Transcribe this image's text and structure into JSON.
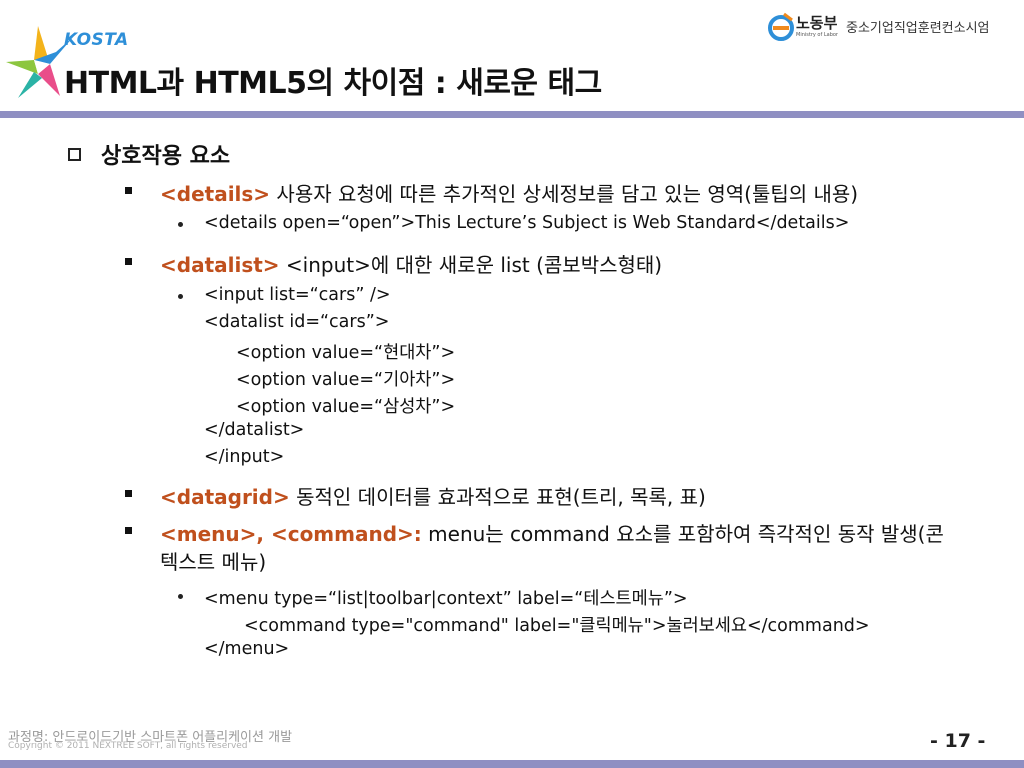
{
  "header": {
    "brand": "KOSTA",
    "title": "HTML과 HTML5의 차이점 : 새로운 태그",
    "ministry_kr": "노동부",
    "ministry_en": "Ministry of Labor",
    "institute": "중소기업직업훈련컨소시엄"
  },
  "section": {
    "title": "상호작용 요소"
  },
  "items": {
    "details": {
      "tag": "<details>",
      "desc": " 사용자 요청에 따른 추가적인 상세정보를 담고 있는 영역(툴팁의 내용)",
      "example": "<details open=“open”>This Lecture’s Subject is Web Standard</details>"
    },
    "datalist": {
      "tag": "<datalist>",
      "desc": " <input>에 대한 새로운 list (콤보박스형태)",
      "code": [
        "<input list=“cars” />",
        "<datalist id=“cars”>",
        "<option value=“현대차”>",
        "<option value=“기아차”>",
        "<option value=“삼성차”>",
        "</datalist>",
        "</input>"
      ]
    },
    "datagrid": {
      "tag": "<datagrid>",
      "desc": " 동적인 데이터를 효과적으로 표현(트리, 목록, 표)"
    },
    "menu": {
      "tag": "<menu>, <command>:",
      "desc1": " menu는 command 요소를 포함하여 즉각적인 동작 발생(콘",
      "desc2": "텍스트 메뉴)",
      "code": [
        "<menu type=“list|toolbar|context” label=“테스트메뉴”>",
        "<command type=\"command\" label=\"클릭메뉴\">눌러보세요</command>",
        "</menu>"
      ]
    }
  },
  "footer": {
    "course": "과정명: 안드로이드기반 스마트폰 어플리케이션 개발",
    "copyright": "Copyright © 2011 NEXTREE SOFT, all rights reserved",
    "page": "- 17 -"
  },
  "colors": {
    "accent_tag": "#c0501d",
    "rule": "#8f8fc2",
    "brand_blue": "#2e8fd8"
  }
}
